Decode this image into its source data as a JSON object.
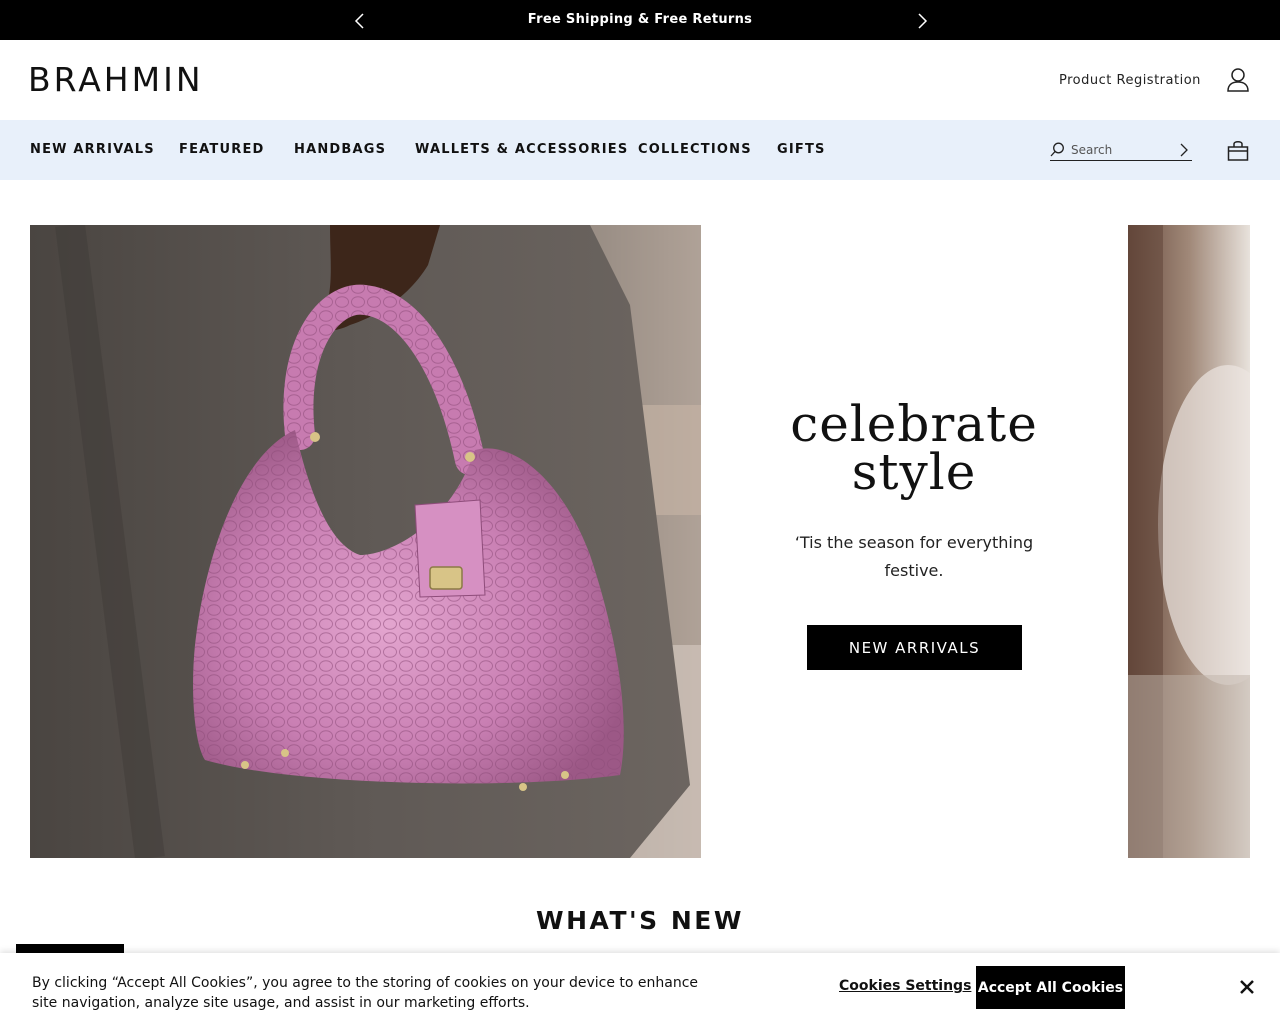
{
  "promo": {
    "text": "Free Shipping & Free Returns",
    "prev_icon": "chevron-left-icon",
    "next_icon": "chevron-right-icon"
  },
  "header": {
    "logo": "BRAHMIN",
    "product_registration": "Product Registration",
    "account_icon": "user-icon"
  },
  "nav": {
    "items": [
      {
        "label": "NEW ARRIVALS"
      },
      {
        "label": "FEATURED"
      },
      {
        "label": "HANDBAGS"
      },
      {
        "label": "WALLETS & ACCESSORIES"
      },
      {
        "label": "COLLECTIONS"
      },
      {
        "label": "GIFTS"
      }
    ],
    "search": {
      "placeholder": "Search",
      "icon": "search-icon",
      "submit_icon": "chevron-right-icon"
    },
    "bag_icon": "shopping-bag-icon"
  },
  "hero": {
    "title_line1": "celebrate",
    "title_line2": "style",
    "subtitle": "‘Tis the season for everything festive.",
    "cta_label": "NEW ARRIVALS",
    "bag_color": "#c77bb0"
  },
  "section": {
    "whats_new": "WHAT'S NEW"
  },
  "cookie_banner": {
    "text": "By clicking “Accept All Cookies”, you agree to the storing of cookies on your device to enhance site navigation, analyze site usage, and assist in our marketing efforts.",
    "settings_label": "Cookies Settings",
    "accept_label": "Accept All Cookies",
    "close_icon": "close-icon"
  }
}
